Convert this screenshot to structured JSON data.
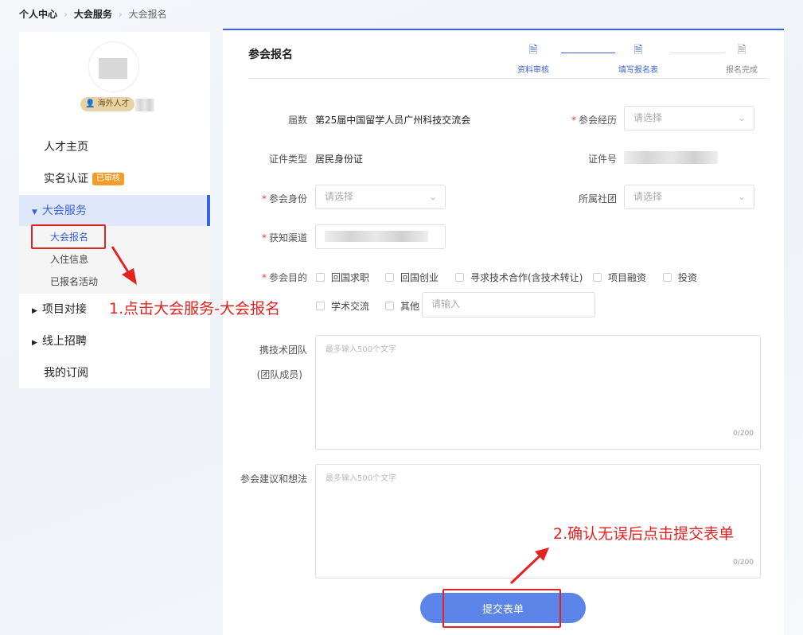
{
  "breadcrumb": [
    "个人中心",
    "大会服务",
    "大会报名"
  ],
  "profile": {
    "badge": "海外人才"
  },
  "sidebar": {
    "items": [
      {
        "label": "人才主页"
      },
      {
        "label": "实名认证",
        "tag": "已审核"
      },
      {
        "label": "大会服务"
      },
      {
        "label": "项目对接"
      },
      {
        "label": "线上招聘"
      },
      {
        "label": "我的订阅"
      }
    ],
    "sub": [
      "大会报名",
      "入住信息",
      "已报名活动"
    ]
  },
  "page": {
    "title": "参会报名"
  },
  "steps": [
    {
      "label": "资料审核"
    },
    {
      "label": "填写报名表"
    },
    {
      "label": "报名完成"
    }
  ],
  "form": {
    "session_label": "届数",
    "session_value": "第25届中国留学人员广州科技交流会",
    "experience_label": "参会经历",
    "experience_placeholder": "请选择",
    "id_type_label": "证件类型",
    "id_type_value": "居民身份证",
    "id_no_label": "证件号",
    "identity_label": "参会身份",
    "identity_placeholder": "请选择",
    "society_label": "所属社团",
    "society_placeholder": "请选择",
    "channel_label": "获知渠道",
    "purpose_label": "参会目的",
    "purposes": [
      "回国求职",
      "回国创业",
      "寻求技术合作(含技术转让)",
      "项目融资",
      "投资",
      "学术交流",
      "其他"
    ],
    "other_placeholder": "请输入",
    "team_label": "携技术团队",
    "team_sub": "(团队成员)",
    "team_placeholder": "最多输入500个文字",
    "team_count": "0/200",
    "advice_label": "参会建议和想法",
    "advice_placeholder": "最多输入500个文字",
    "advice_count": "0/200",
    "submit": "提交表单"
  },
  "annotations": [
    "1.点击大会服务-大会报名",
    "2.确认无误后点击提交表单"
  ],
  "colors": {
    "accent": "#3b63d8",
    "annotation": "#e52222"
  }
}
